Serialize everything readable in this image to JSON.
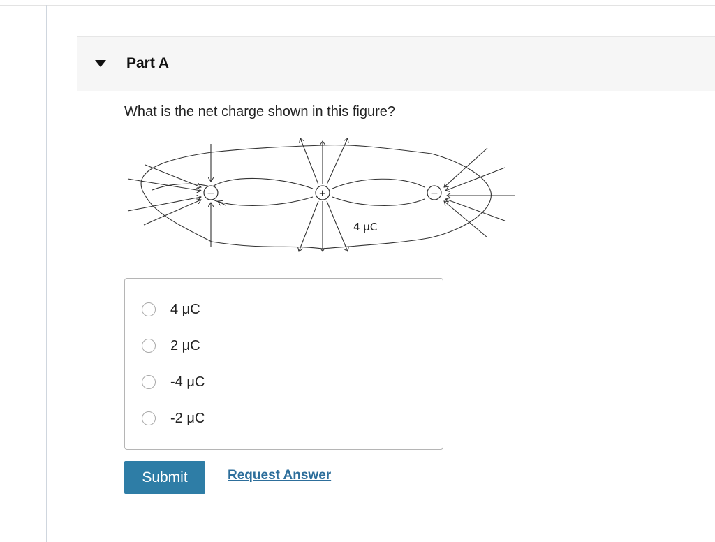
{
  "part": {
    "title": "Part A"
  },
  "question": {
    "text": "What is the net charge shown in this figure?"
  },
  "figure": {
    "center_charge_sign": "+",
    "side_charge_sign": "−",
    "charge_label": "4 μC"
  },
  "choices": [
    {
      "label": "4 μC",
      "selected": false
    },
    {
      "label": "2 μC",
      "selected": false
    },
    {
      "label": "-4 μC",
      "selected": false
    },
    {
      "label": "-2 μC",
      "selected": false
    }
  ],
  "actions": {
    "submit_label": "Submit",
    "request_answer_label": "Request Answer"
  },
  "colors": {
    "submit_bg": "#2e7da6",
    "link": "#2d6e9b",
    "header_bg": "#f6f6f6"
  }
}
